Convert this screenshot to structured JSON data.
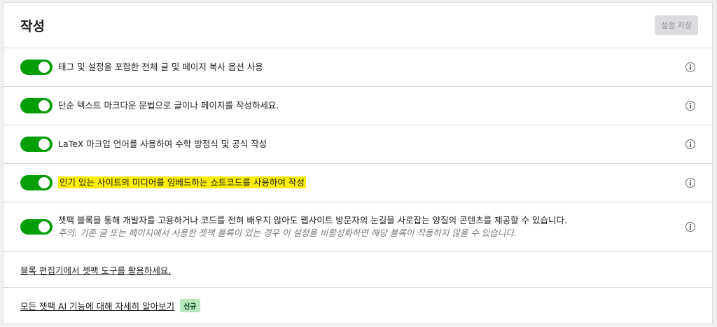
{
  "header": {
    "title": "작성",
    "save_label": "설정 저장"
  },
  "settings": [
    {
      "label": "태그 및 설정을 포함한 전체 글 및 페이지 복사 옵션 사용",
      "enabled": true
    },
    {
      "label": "단순 텍스트 마크다운 문법으로 글이나 페이지를 작성하세요.",
      "enabled": true
    },
    {
      "label": "LaTeX 마크업 언어를 사용하여 수학 방정식 및 공식 작성",
      "enabled": true
    },
    {
      "label": "인기 있는 사이트의 미디어를 임베드하는 쇼트코드를 사용하여 작성",
      "enabled": true,
      "highlighted": true
    },
    {
      "label": "젯팩 블록을 통해 개발자를 고용하거나 코드를 전혀 배우지 않아도 웹사이트 방문자의 눈길을 사로잡는 양질의 콘텐츠를 제공할 수 있습니다.",
      "note": "주의: 기존 글 또는 페이지에서 사용한 젯팩 블록이 있는 경우 이 설정을 비활성화하면 해당 블록이 작동하지 않을 수 있습니다.",
      "enabled": true
    }
  ],
  "links": {
    "block_editor": "블록 편집기에서 젯팩 도구를 활용하세요.",
    "ai_features": "모든 젯팩 AI 기능에 대해 자세히 알아보기",
    "new_badge": "신규"
  },
  "colors": {
    "toggle_on": "#069e08",
    "highlight": "#ffee00",
    "badge_bg": "#b8e6bf"
  }
}
